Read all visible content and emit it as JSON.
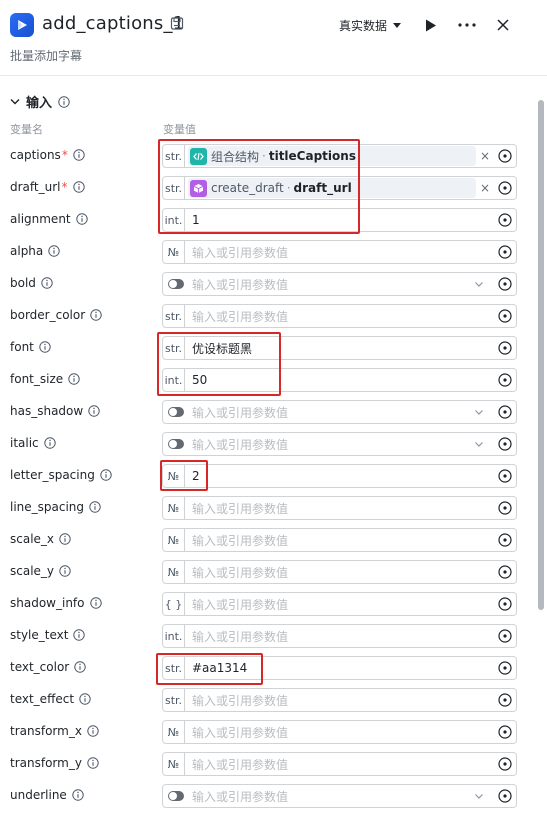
{
  "header": {
    "title": "add_captions_1",
    "subtitle": "批量添加字幕",
    "mode_label": "真实数据"
  },
  "section": {
    "title": "输入",
    "col_name": "变量名",
    "col_value": "变量值"
  },
  "placeholder": "输入或引用参数值",
  "params": [
    {
      "name": "captions",
      "required": true,
      "type_tag": "str.",
      "kind": "ref",
      "ref_node": "组合结构",
      "ref_var": "titleCaptions",
      "icon": "code-node-icon",
      "icon_color": "#1fb5a8"
    },
    {
      "name": "draft_url",
      "required": true,
      "type_tag": "str.",
      "kind": "ref",
      "ref_node": "create_draft",
      "ref_var": "draft_url",
      "icon": "plugin-cube-icon",
      "icon_color": "#b25fe6"
    },
    {
      "name": "alignment",
      "required": false,
      "type_tag": "int.",
      "kind": "value",
      "value": "1"
    },
    {
      "name": "alpha",
      "required": false,
      "type_tag": "№",
      "kind": "empty"
    },
    {
      "name": "bold",
      "required": false,
      "type_tag": "toggle",
      "kind": "bool"
    },
    {
      "name": "border_color",
      "required": false,
      "type_tag": "str.",
      "kind": "empty"
    },
    {
      "name": "font",
      "required": false,
      "type_tag": "str.",
      "kind": "value",
      "value": "优设标题黑"
    },
    {
      "name": "font_size",
      "required": false,
      "type_tag": "int.",
      "kind": "value",
      "value": "50"
    },
    {
      "name": "has_shadow",
      "required": false,
      "type_tag": "toggle",
      "kind": "bool"
    },
    {
      "name": "italic",
      "required": false,
      "type_tag": "toggle",
      "kind": "bool"
    },
    {
      "name": "letter_spacing",
      "required": false,
      "type_tag": "№",
      "kind": "value",
      "value": "2"
    },
    {
      "name": "line_spacing",
      "required": false,
      "type_tag": "№",
      "kind": "empty"
    },
    {
      "name": "scale_x",
      "required": false,
      "type_tag": "№",
      "kind": "empty"
    },
    {
      "name": "scale_y",
      "required": false,
      "type_tag": "№",
      "kind": "empty"
    },
    {
      "name": "shadow_info",
      "required": false,
      "type_tag": "{ }",
      "kind": "empty"
    },
    {
      "name": "style_text",
      "required": false,
      "type_tag": "int.",
      "kind": "empty"
    },
    {
      "name": "text_color",
      "required": false,
      "type_tag": "str.",
      "kind": "value",
      "value": "#aa1314"
    },
    {
      "name": "text_effect",
      "required": false,
      "type_tag": "str.",
      "kind": "empty"
    },
    {
      "name": "transform_x",
      "required": false,
      "type_tag": "№",
      "kind": "empty"
    },
    {
      "name": "transform_y",
      "required": false,
      "type_tag": "№",
      "kind": "empty"
    },
    {
      "name": "underline",
      "required": false,
      "type_tag": "toggle",
      "kind": "bool"
    }
  ],
  "colors": {
    "accent": "#2a6df4",
    "annotation_red": "#d62828",
    "required_star": "#f54a45"
  }
}
